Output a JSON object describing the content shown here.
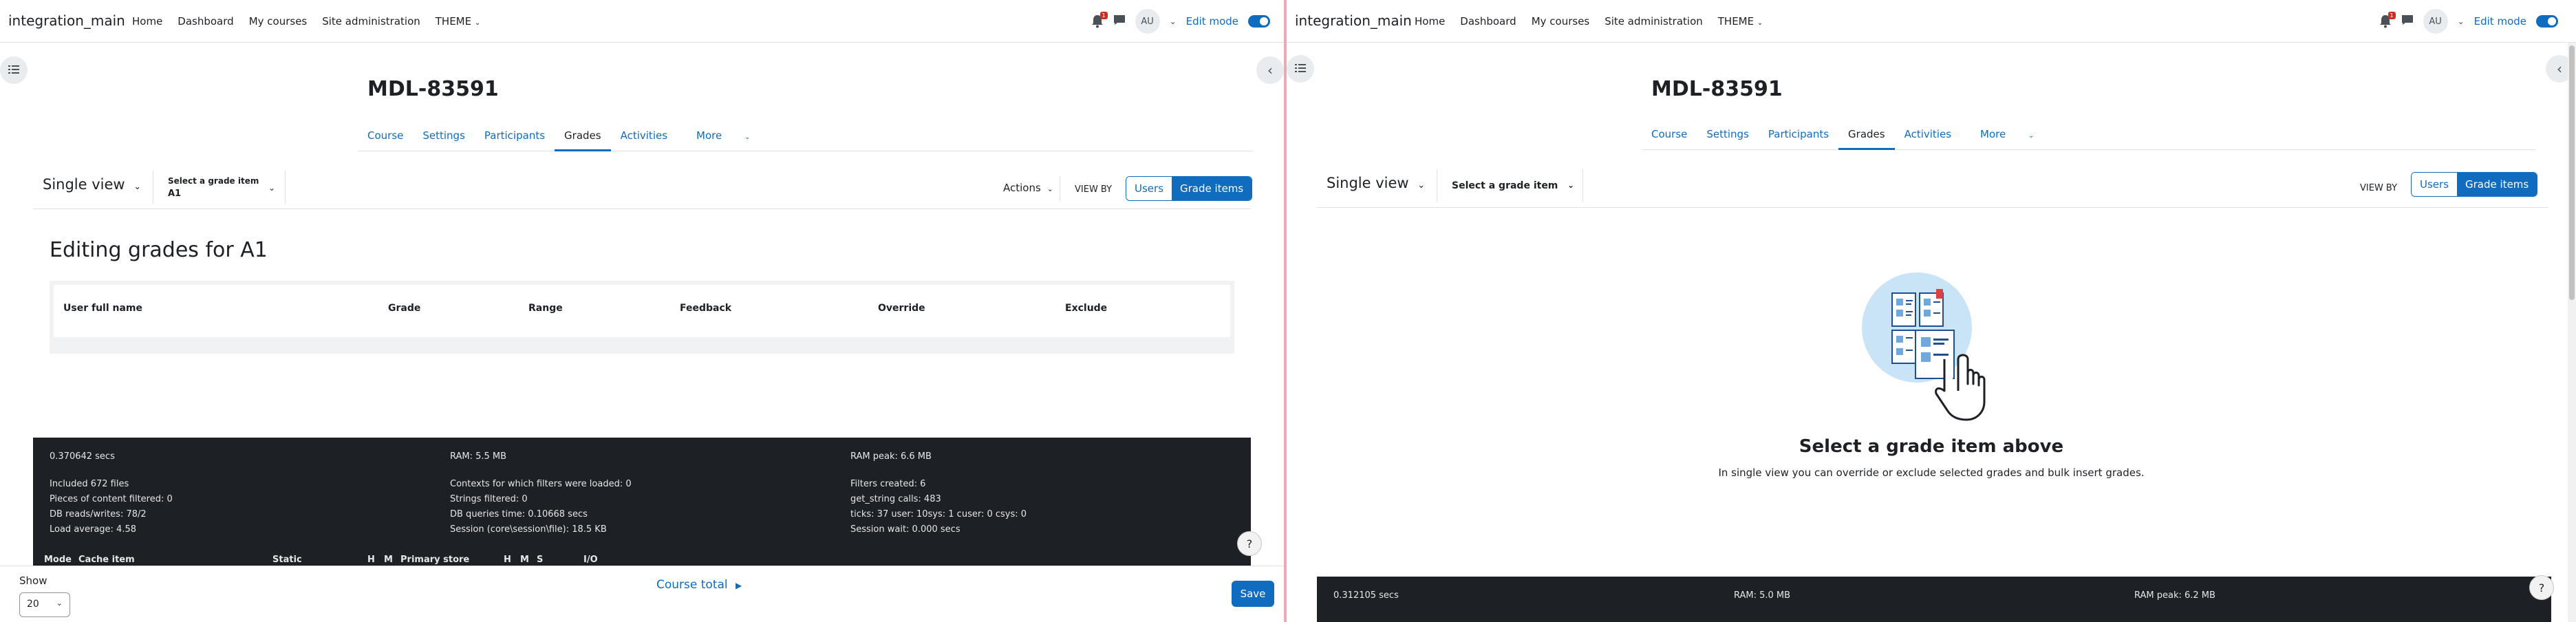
{
  "navbar": {
    "brand": "integration_main",
    "links": [
      "Home",
      "Dashboard",
      "My courses",
      "Site administration",
      "THEME"
    ],
    "notification_count": "1",
    "avatar_initials": "AU",
    "edit_mode_label": "Edit mode"
  },
  "course": {
    "title": "MDL-83591",
    "tabs": [
      "Course",
      "Settings",
      "Participants",
      "Grades",
      "Activities",
      "More"
    ],
    "active_tab": "Grades"
  },
  "left": {
    "report_selector": "Single view",
    "grade_item_label": "Select a grade item",
    "grade_item_value": "A1",
    "actions_label": "Actions",
    "view_by_label": "VIEW BY",
    "view_by_options": [
      "Users",
      "Grade items"
    ],
    "view_by_active": "Grade items",
    "heading": "Editing grades for A1",
    "table_columns": [
      "User full name",
      "Grade",
      "Range",
      "Feedback",
      "Override",
      "Exclude"
    ],
    "perf": {
      "time": "0.370642 secs",
      "ram": "RAM: 5.5 MB",
      "ram_peak": "RAM peak: 6.6 MB",
      "col1": [
        "Included 672 files",
        "Pieces of content filtered: 0",
        "DB reads/writes: 78/2",
        "Load average: 4.58"
      ],
      "col2": [
        "Contexts for which filters were loaded: 0",
        "Strings filtered: 0",
        "DB queries time: 0.10668 secs",
        "Session (core\\session\\file): 18.5 KB"
      ],
      "col3": [
        "Filters created: 6",
        "get_string calls: 483",
        "ticks: 37 user: 10sys: 1 cuser: 0 csys: 0",
        "Session wait: 0.000 secs"
      ],
      "cache_headers": [
        "Mode",
        "Cache item",
        "Static",
        "H",
        "M",
        "Primary store",
        "H",
        "M",
        "S",
        "I/O"
      ]
    },
    "footer": {
      "show_label": "Show",
      "per_page": "20",
      "course_total": "Course total",
      "save": "Save"
    }
  },
  "right": {
    "report_selector": "Single view",
    "grade_item_label": "Select a grade item",
    "view_by_label": "VIEW BY",
    "view_by_options": [
      "Users",
      "Grade items"
    ],
    "view_by_active": "Grade items",
    "empty_title": "Select a grade item above",
    "empty_desc": "In single view you can override or exclude selected grades and bulk insert grades.",
    "perf": {
      "time": "0.312105 secs",
      "ram": "RAM: 5.0 MB",
      "ram_peak": "RAM peak: 6.2 MB"
    }
  },
  "help_icon": "?",
  "colors": {
    "primary": "#0f6cbf",
    "dark": "#1d2125",
    "badge": "#ca3120"
  }
}
